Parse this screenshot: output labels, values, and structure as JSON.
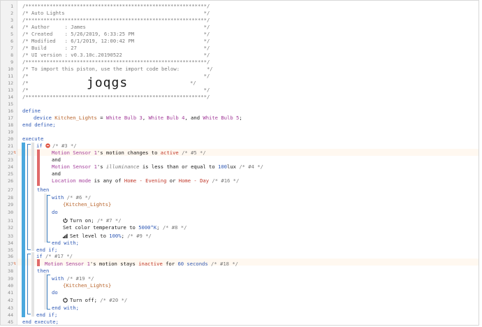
{
  "line_numbers": [
    "1",
    "2",
    "3",
    "4",
    "5",
    "6",
    "7",
    "8",
    "9",
    "10",
    "11",
    "12",
    "13",
    "14",
    "15",
    "16",
    "17",
    "18",
    "19",
    "20",
    "21",
    "22",
    "23",
    "24",
    "25",
    "26",
    "27",
    "28",
    "29",
    "30",
    "31",
    "32",
    "33",
    "34",
    "35",
    "36",
    "37",
    "38",
    "39",
    "40",
    "41",
    "42",
    "43",
    "44",
    "45"
  ],
  "header": {
    "border": "/************************************************************/",
    "title": "/* Auto Lights                                              */",
    "author": "/* Author     : James                                       */",
    "created": "/* Created    : 5/26/2019, 6:33:25 PM                       */",
    "modified": "/* Modified   : 6/1/2019, 12:00:42 PM                       */",
    "build": "/* Build      : 27                                          */",
    "ui_version": "/* UI version : v0.3.10c.20190522                           */",
    "import_line": "/* To import this piston, use the import code below:         */",
    "blank": "/*                                                          */",
    "import_prefix": "/*",
    "import_code": "joqgs",
    "import_suffix": "*/"
  },
  "code": {
    "define": "define",
    "device_kw": "device",
    "device_var": "Kitchen_Lights",
    "eq": " = ",
    "bulb3": "White Bulb 3",
    "comma1": ", ",
    "bulb4": "White Bulb 4",
    "and_word": ", and ",
    "bulb5": "White Bulb 5",
    "semi": ";",
    "end_define": "end define;",
    "execute": "execute",
    "if1": "if",
    "if1_cmt": "/* #3 */",
    "c1_dev": "Motion Sensor 1",
    "c1_txt": "'s motion changes to ",
    "c1_val": "active",
    "c1_cmt": "/* #5 */",
    "and1": "and",
    "c2_dev": "Motion Sensor 1",
    "c2_txt": "'s ",
    "c2_attr": "illuminance",
    "c2_txt2": " is less than or equal to ",
    "c2_val": "100",
    "c2_unit": "lux",
    "c2_cmt": "/* #4 */",
    "and2": "and",
    "c3_dev": "Location mode",
    "c3_txt": " is any of ",
    "c3_v1": "Home - Evening",
    "c3_or": " or ",
    "c3_v2": "Home - Day",
    "c3_cmt": "/* #16 */",
    "then1": "then",
    "with1": "with",
    "with1_cmt": "/* #6 */",
    "with1_dev": "{Kitchen_Lights}",
    "do1": "do",
    "turn_on": "Turn on;",
    "turn_on_cmt": "/* #7 */",
    "set_temp": "Set color temperature to ",
    "set_temp_val": "5000°K",
    "set_temp_semi": ";",
    "set_temp_cmt": "/* #8 */",
    "set_level": "Set level to ",
    "set_level_val": "100%",
    "set_level_semi": ";",
    "set_level_cmt": "/* #9 */",
    "end_with1": "end with;",
    "end_if1": "end if;",
    "if2": "if",
    "if2_cmt": "/* #17 */",
    "c4_dev": "Motion Sensor 1",
    "c4_txt": "'s motion stays ",
    "c4_val": "inactive",
    "c4_txt2": " for ",
    "c4_num": "60 seconds",
    "c4_cmt": "/* #18 */",
    "then2": "then",
    "with2": "with",
    "with2_cmt": "/* #19 */",
    "with2_dev": "{Kitchen_Lights}",
    "do2": "do",
    "turn_off": "Turn off;",
    "turn_off_cmt": "/* #20 */",
    "end_with2": "end with;",
    "end_if2": "end if;",
    "end_execute": "end execute;"
  },
  "markers": {
    "line23": "↯",
    "line37": "↯"
  },
  "colors": {
    "comment": "#7a7a7a",
    "keyword": "#2f59b5",
    "device": "#a33d9a",
    "string": "#c0392b",
    "bar_blue": "#4aa8de",
    "bar_red": "#e06a6a"
  },
  "icons": {
    "if_badge": "stop-circle-icon",
    "turn_on": "power-icon",
    "set_level": "signal-bars-icon",
    "turn_off": "power-off-icon"
  }
}
